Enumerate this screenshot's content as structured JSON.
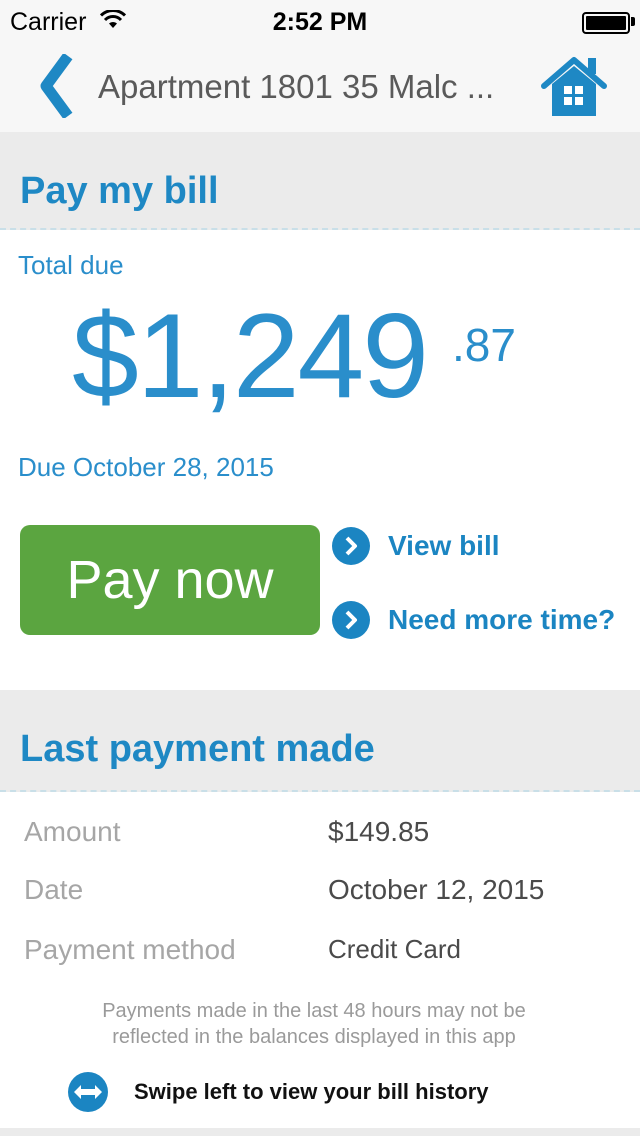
{
  "status_bar": {
    "carrier": "Carrier",
    "time": "2:52 PM"
  },
  "nav": {
    "title": "Apartment 1801 35 Malc ...",
    "back_icon": "chevron-left-icon",
    "home_icon": "home-icon"
  },
  "pay_section": {
    "title": "Pay my bill",
    "total_label": "Total due",
    "amount_whole": "$1,249",
    "amount_cents": ".87",
    "due_date": "Due October 28, 2015",
    "pay_button": "Pay now",
    "links": [
      {
        "label": "View bill"
      },
      {
        "label": "Need more time?"
      }
    ]
  },
  "last_payment": {
    "title": "Last payment made",
    "rows": [
      {
        "label": "Amount",
        "value": "$149.85"
      },
      {
        "label": "Date",
        "value": "October 12, 2015"
      },
      {
        "label": "Payment method",
        "value": "Credit Card"
      }
    ],
    "note_line1": "Payments made in the last 48 hours may not be",
    "note_line2": "reflected in the balances displayed in this app",
    "swipe_hint": "Swipe left to view your bill history"
  },
  "colors": {
    "accent": "#2a8ecb",
    "link": "#1b85c2",
    "pay_button": "#5ba540",
    "section_bg": "#ebebeb"
  }
}
